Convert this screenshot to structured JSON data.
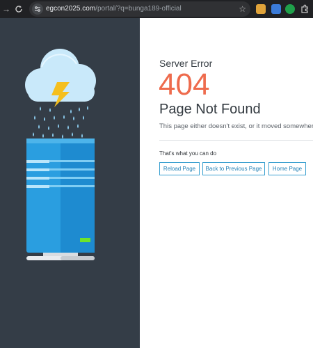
{
  "browser": {
    "url_host": "egcon2025.com",
    "url_path": "/portal/?q=bunga189-official"
  },
  "error_page": {
    "subtitle": "Server Error",
    "code": "404",
    "title": "Page Not Found",
    "description": "This page either doesn't exist, or it moved somewhere else.",
    "actions_heading": "That's what you can do",
    "buttons": {
      "reload": "Reload Page",
      "back": "Back to Previous Page",
      "home": "Home Page"
    }
  },
  "colors": {
    "accent_orange": "#ee6b4d",
    "button_blue": "#3aa0d0",
    "panel_dark": "#343d47",
    "server_blue": "#2a9ee0"
  },
  "icons": [
    "back-arrow-icon",
    "reload-icon",
    "site-info-icon",
    "star-icon",
    "extensions-icon",
    "storm-cloud-icon",
    "server-icon"
  ]
}
